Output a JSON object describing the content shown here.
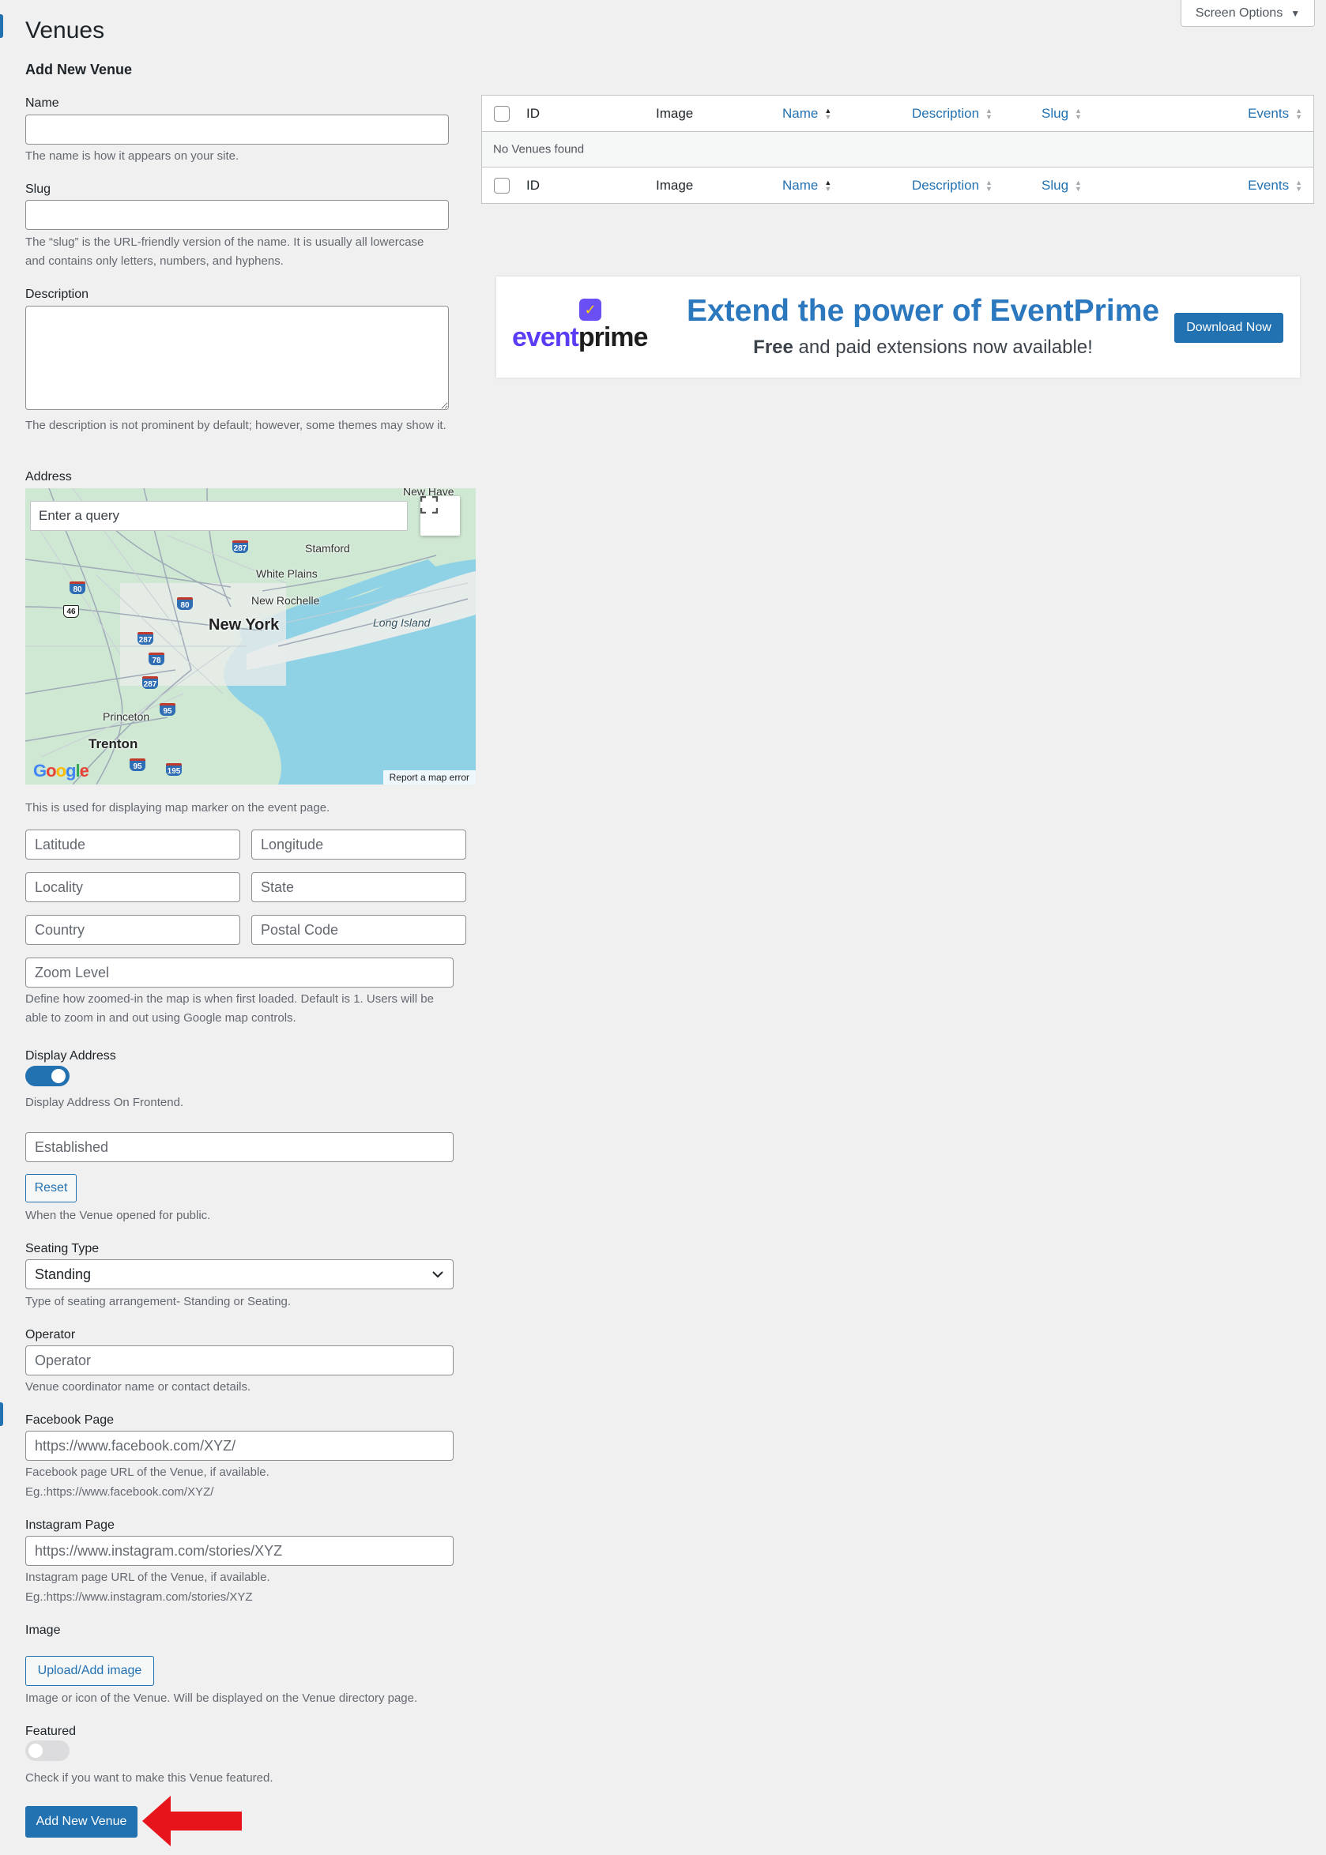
{
  "page": {
    "title": "Venues",
    "screen_options": "Screen Options"
  },
  "form": {
    "heading": "Add New Venue",
    "name": {
      "label": "Name",
      "value": "",
      "help": "The name is how it appears on your site."
    },
    "slug": {
      "label": "Slug",
      "value": "",
      "help": "The “slug” is the URL-friendly version of the name. It is usually all lowercase and contains only letters, numbers, and hyphens."
    },
    "description": {
      "label": "Description",
      "value": "",
      "help": "The description is not prominent by default; however, some themes may show it."
    },
    "address": {
      "label": "Address",
      "map": {
        "search_placeholder": "Enter a query",
        "labels": [
          "New Have",
          "Stamford",
          "White Plains",
          "New Rochelle",
          "New York",
          "Long Island",
          "Princeton",
          "Trenton"
        ],
        "shields": [
          "287",
          "80",
          "46",
          "80",
          "287",
          "78",
          "287",
          "95",
          "95",
          "195"
        ],
        "report_error": "Report a map error"
      },
      "help": "This is used for displaying map marker on the event page."
    },
    "latitude": {
      "placeholder": "Latitude"
    },
    "longitude": {
      "placeholder": "Longitude"
    },
    "locality": {
      "placeholder": "Locality"
    },
    "state": {
      "placeholder": "State"
    },
    "country": {
      "placeholder": "Country"
    },
    "postal_code": {
      "placeholder": "Postal Code"
    },
    "zoom_level": {
      "placeholder": "Zoom Level",
      "help": "Define how zoomed-in the map is when first loaded. Default is 1. Users will be able to zoom in and out using Google map controls."
    },
    "display_address": {
      "label": "Display Address",
      "checked": true,
      "help": "Display Address On Frontend."
    },
    "established": {
      "placeholder": "Established",
      "reset_label": "Reset",
      "help": "When the Venue opened for public."
    },
    "seating_type": {
      "label": "Seating Type",
      "selected": "Standing",
      "help": "Type of seating arrangement- Standing or Seating."
    },
    "operator": {
      "label": "Operator",
      "placeholder": "Operator",
      "help": "Venue coordinator name or contact details."
    },
    "facebook": {
      "label": "Facebook Page",
      "placeholder": "https://www.facebook.com/XYZ/",
      "help1": "Facebook page URL of the Venue, if available.",
      "help2": "Eg.:https://www.facebook.com/XYZ/"
    },
    "instagram": {
      "label": "Instagram Page",
      "placeholder": "https://www.instagram.com/stories/XYZ",
      "help1": "Instagram page URL of the Venue, if available.",
      "help2": "Eg.:https://www.instagram.com/stories/XYZ"
    },
    "image": {
      "label": "Image",
      "button": "Upload/Add image",
      "help": "Image or icon of the Venue. Will be displayed on the Venue directory page."
    },
    "featured": {
      "label": "Featured",
      "checked": false,
      "help": "Check if you want to make this Venue featured."
    },
    "submit": "Add New Venue"
  },
  "table": {
    "columns": [
      "ID",
      "Image",
      "Name",
      "Description",
      "Slug",
      "Events"
    ],
    "empty_message": "No Venues found"
  },
  "banner": {
    "logo_event": "event",
    "logo_prime": "prime",
    "headline": "Extend the power of EventPrime",
    "sub_free": "Free",
    "sub_rest": " and paid extensions now available!",
    "button": "Download Now"
  },
  "colors": {
    "accent": "#2271b1",
    "arrow": "#e8141b",
    "banner_headline": "#2b78bf"
  }
}
